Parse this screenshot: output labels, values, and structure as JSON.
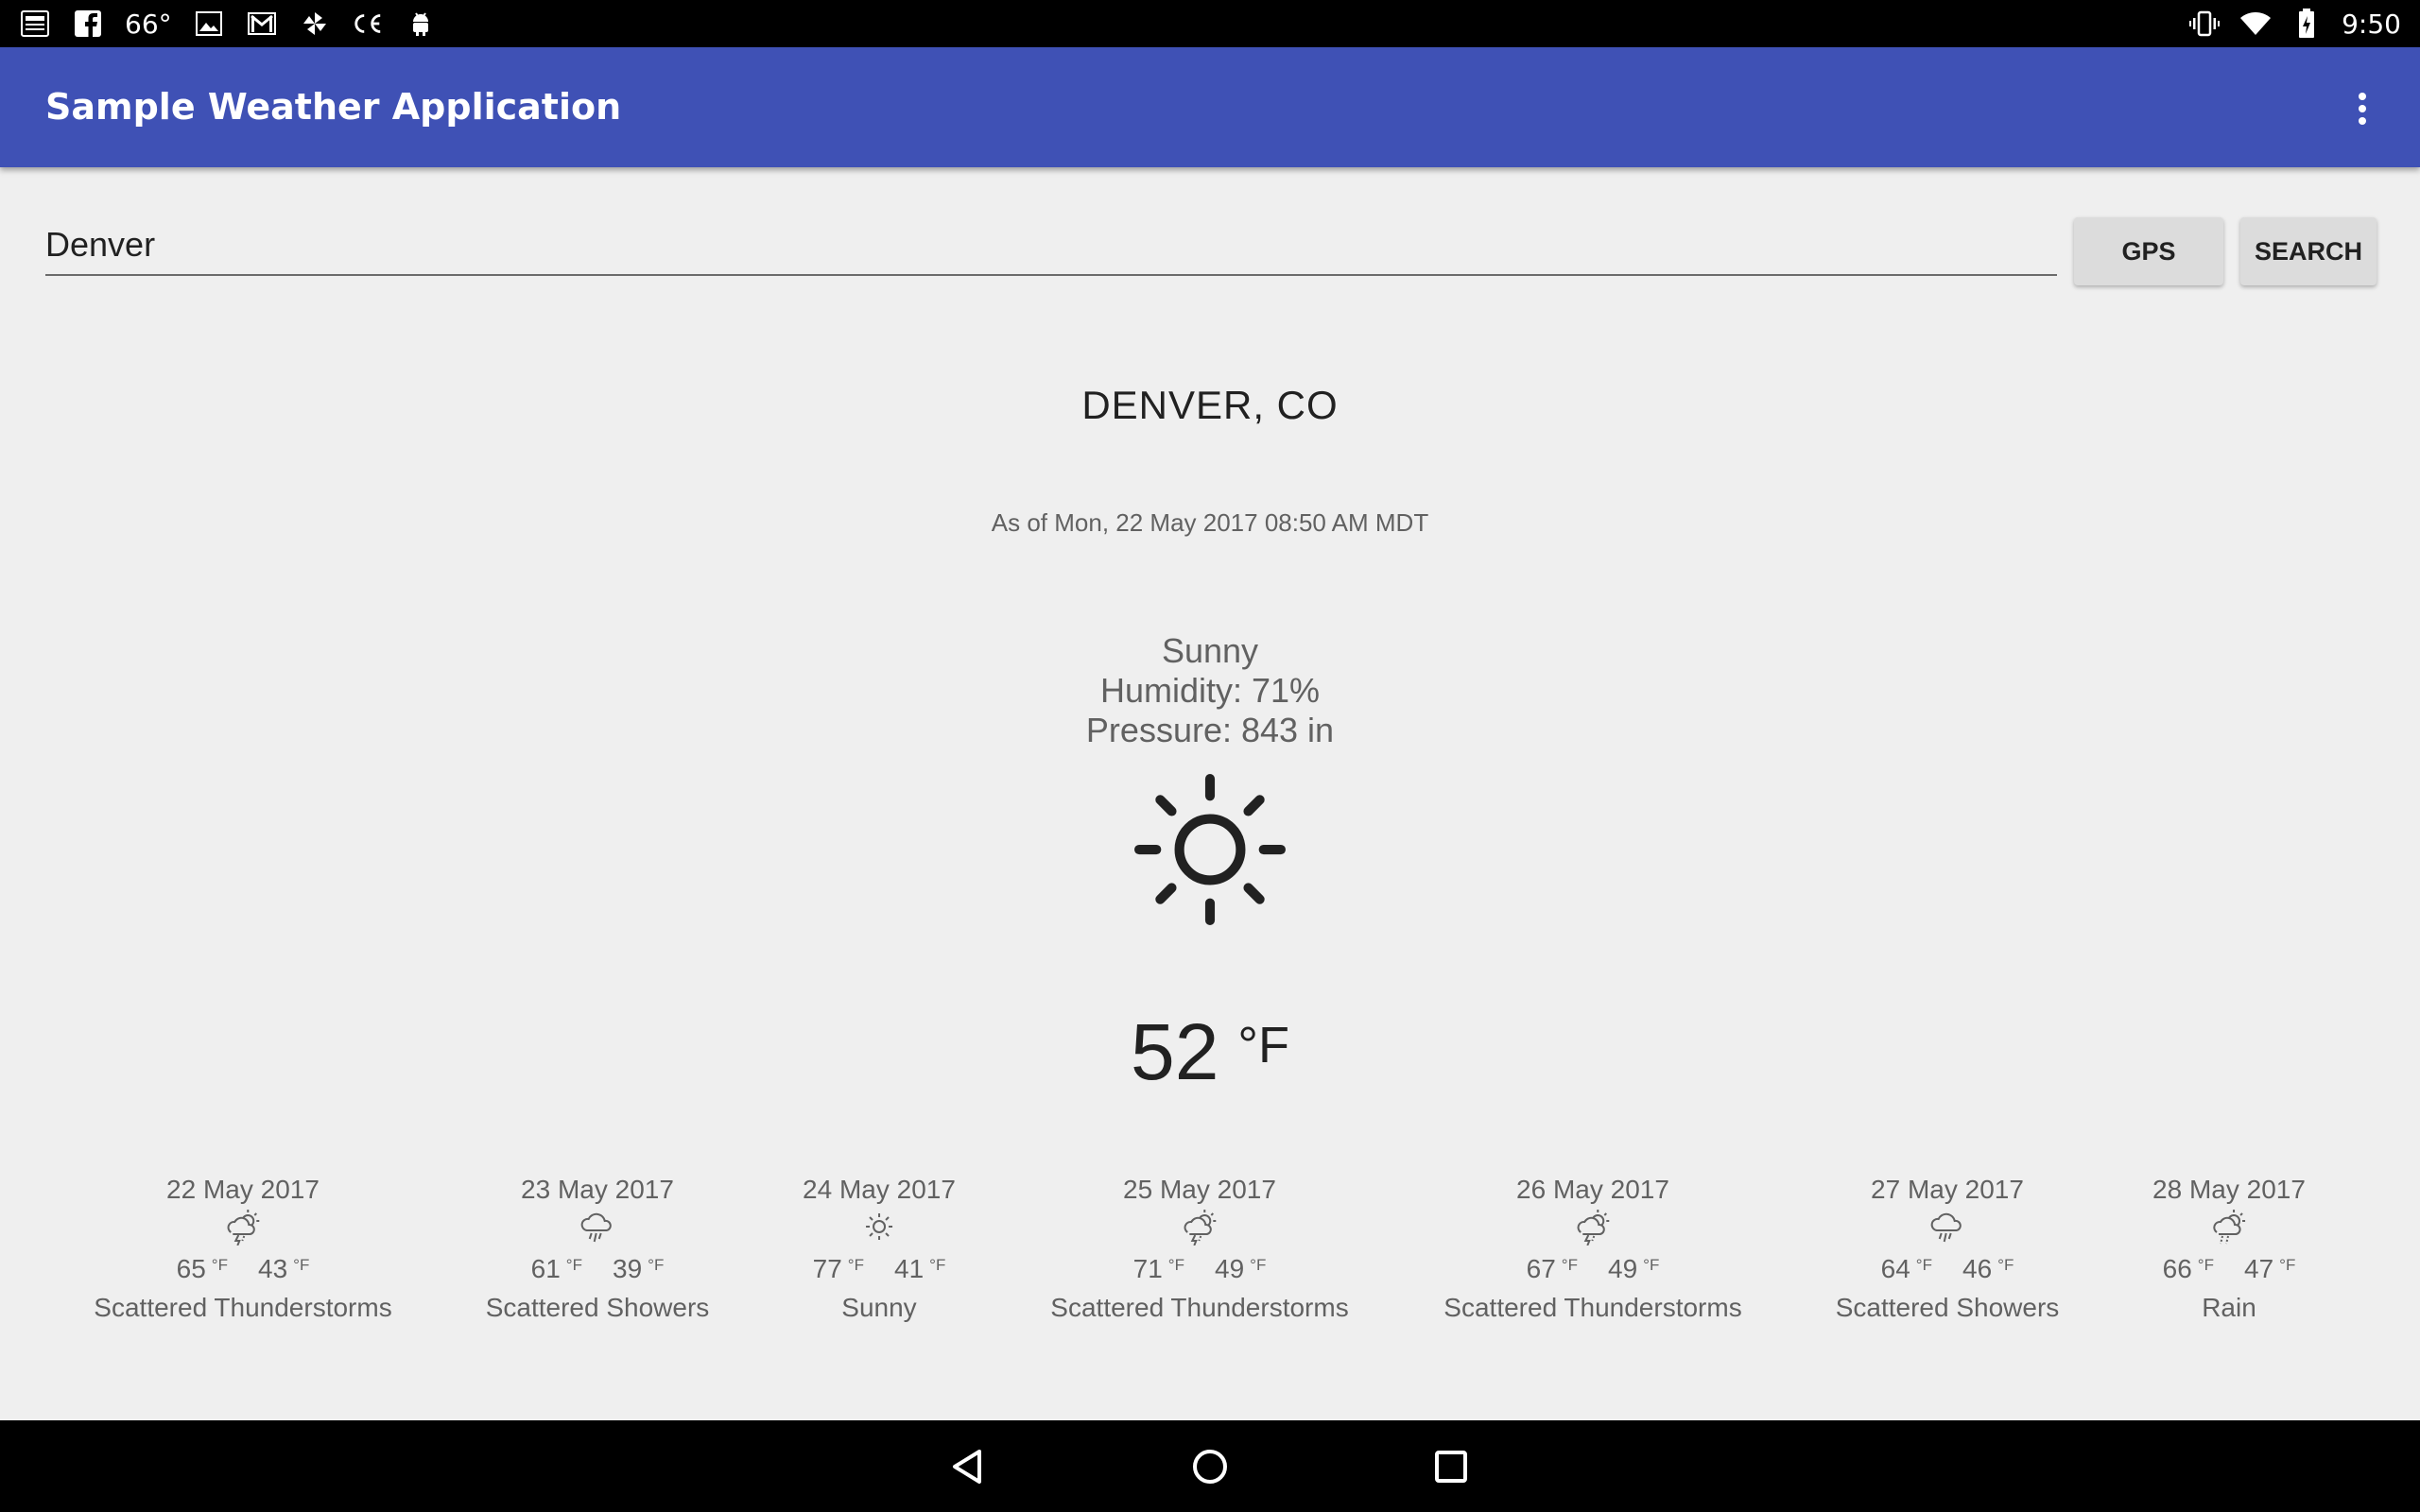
{
  "status_bar": {
    "temperature": "66°",
    "time": "9:50",
    "left_icons": [
      "news-icon",
      "facebook-icon",
      "image-icon",
      "gmail-icon",
      "pinwheel-icon",
      "ce-icon",
      "android-icon"
    ],
    "right_icons": [
      "vibrate-icon",
      "wifi-icon",
      "battery-icon"
    ]
  },
  "app_bar": {
    "title": "Sample Weather Application",
    "overflow_icon": "more-vert-icon"
  },
  "search": {
    "value": "Denver",
    "gps_label": "GPS",
    "search_label": "SEARCH"
  },
  "current": {
    "city": "DENVER,  CO",
    "as_of": "As of Mon, 22 May 2017 08:50 AM MDT",
    "condition": "Sunny",
    "humidity": "Humidity: 71%",
    "pressure": "Pressure: 843 in",
    "icon": "sun-icon",
    "temperature": "52",
    "unit": "°F"
  },
  "forecast": [
    {
      "date": "22 May 2017",
      "high": "65",
      "low": "43",
      "unit": "°F",
      "condition": "Scattered Thunderstorms",
      "icon": "thunderstorm-icon"
    },
    {
      "date": "23 May 2017",
      "high": "61",
      "low": "39",
      "unit": "°F",
      "condition": "Scattered Showers",
      "icon": "showers-icon"
    },
    {
      "date": "24 May 2017",
      "high": "77",
      "low": "41",
      "unit": "°F",
      "condition": "Sunny",
      "icon": "sun-icon"
    },
    {
      "date": "25 May 2017",
      "high": "71",
      "low": "49",
      "unit": "°F",
      "condition": "Scattered Thunderstorms",
      "icon": "thunderstorm-icon"
    },
    {
      "date": "26 May 2017",
      "high": "67",
      "low": "49",
      "unit": "°F",
      "condition": "Scattered Thunderstorms",
      "icon": "thunderstorm-icon"
    },
    {
      "date": "27 May 2017",
      "high": "64",
      "low": "46",
      "unit": "°F",
      "condition": "Scattered Showers",
      "icon": "showers-icon"
    },
    {
      "date": "28 May 2017",
      "high": "66",
      "low": "47",
      "unit": "°F",
      "condition": "Rain",
      "icon": "rain-icon"
    }
  ],
  "nav_bar": {
    "icons": [
      "back-icon",
      "home-icon",
      "recents-icon"
    ]
  },
  "colors": {
    "primary": "#3f51b5",
    "background": "#efefef",
    "text_primary": "#212121",
    "text_secondary": "#616161"
  }
}
